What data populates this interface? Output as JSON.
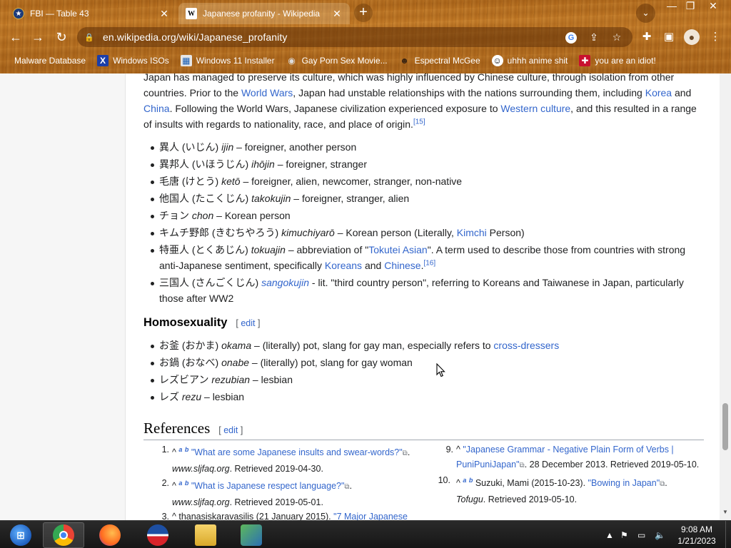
{
  "browser": {
    "tabs": [
      {
        "title": "FBI — Table 43",
        "icon": "fbi-seal-icon"
      },
      {
        "title": "Japanese profanity - Wikipedia",
        "icon": "wikipedia-icon"
      }
    ],
    "url": "en.wikipedia.org/wiki/Japanese_profanity",
    "bookmarks": [
      {
        "label": "Malware Database",
        "icon": "none"
      },
      {
        "label": "Windows ISOs",
        "icon": "x-icon"
      },
      {
        "label": "Windows 11 Installer",
        "icon": "window-icon"
      },
      {
        "label": "Gay Porn Sex Movie...",
        "icon": "globe-icon"
      },
      {
        "label": "Espectral McGee",
        "icon": "mask-icon"
      },
      {
        "label": "uhhh anime shit",
        "icon": "anime-icon"
      },
      {
        "label": "you are an idiot!",
        "icon": "flag-icon"
      }
    ]
  },
  "article": {
    "intro": {
      "t1": "Japan has managed to preserve its culture, which was highly influenced by Chinese culture, through isolation from other countries. Prior to the ",
      "l1": "World Wars",
      "t2": ", Japan had unstable relationships with the nations surrounding them, including ",
      "l2": "Korea",
      "t3": " and ",
      "l3": "China",
      "t4": ". Following the World Wars, Japanese civilization experienced exposure to ",
      "l4": "Western culture",
      "t5": ", and this resulted in a range of insults with regards to nationality, race, and place of origin.",
      "cite": "[15]"
    },
    "nationality_items": [
      {
        "jp": "異人 (いじん) ",
        "rom": "ijin",
        "def": " – foreigner, another person"
      },
      {
        "jp": "異邦人 (いほうじん) ",
        "rom": "ihōjin",
        "def": " – foreigner, stranger"
      },
      {
        "jp": "毛唐 (けとう) ",
        "rom": "ketō",
        "def": " – foreigner, alien, newcomer, stranger, non-native"
      },
      {
        "jp": "他国人 (たこくじん) ",
        "rom": "takokujin",
        "def": " – foreigner, stranger, alien"
      },
      {
        "jp": "チョン ",
        "rom": "chon",
        "def": " – Korean person"
      }
    ],
    "kimuchi": {
      "jp": "キムチ野郎 (きむちやろう) ",
      "rom": "kimuchiyarō",
      "pre": " – Korean person (Literally, ",
      "link": "Kimchi",
      "post": " Person)"
    },
    "tokuajin": {
      "jp": "特亜人 (とくあじん) ",
      "rom": "tokuajin",
      "pre": " – abbreviation of \"",
      "link1": "Tokutei Asian",
      "mid": "\". A term used to describe those from countries with strong anti-Japanese sentiment, specifically ",
      "link2": "Koreans",
      "and": " and ",
      "link3": "Chinese",
      "end": ".",
      "cite": "[16]"
    },
    "sangokujin": {
      "jp": "三国人 (さんごくじん) ",
      "rom_link": "sangokujin",
      "def": " - lit. \"third country person\", referring to Koreans and Taiwanese in Japan, particularly those after WW2"
    },
    "homosexuality": {
      "heading": "Homosexuality",
      "edit": "edit",
      "okama": {
        "jp": "お釜 (おかま) ",
        "rom": "okama",
        "pre": " – (literally) pot, slang for gay man, especially refers to ",
        "link": "cross-dressers"
      },
      "items": [
        {
          "jp": "お鍋 (おなべ) ",
          "rom": "onabe",
          "def": " – (literally) pot, slang for gay woman"
        },
        {
          "jp": "レズビアン ",
          "rom": "rezubian",
          "def": " – lesbian"
        },
        {
          "jp": "レズ ",
          "rom": "rezu",
          "def": " – lesbian"
        }
      ]
    },
    "references": {
      "heading": "References",
      "edit": "edit",
      "r1": {
        "num": "1.",
        "caret": "^",
        "a": "a",
        "b": "b",
        "title": "\"What are some Japanese insults and swear-words?\"",
        "after": ".",
        "site": "www.sljfaq.org",
        "retr": ". Retrieved 2019-04-30."
      },
      "r2": {
        "num": "2.",
        "caret": "^",
        "a": "a",
        "b": "b",
        "title": "\"What is Japanese respect language?\"",
        "after": ".",
        "site": "www.sljfaq.org",
        "retr": ". Retrieved 2019-05-01."
      },
      "r3": {
        "num": "3.",
        "caret": "^",
        "text": " thanasiskaravasilis (21 January 2015). ",
        "title": "\"7 Major Japanese"
      },
      "r9": {
        "num": "9.",
        "caret": "^",
        "title": "\"Japanese Grammar - Negative Plain Form of Verbs | PuniPuniJapan\"",
        "rest": ". 28 December 2013. Retrieved 2019-05-10."
      },
      "r10": {
        "num": "10.",
        "caret": "^",
        "a": "a",
        "b": "b",
        "text": " Suzuki, Mami (2015-10-23). ",
        "title": "\"Bowing in Japan\"",
        "after": ".",
        "site": "Tofugu",
        "retr": ". Retrieved 2019-05-10."
      }
    }
  },
  "taskbar": {
    "apps": [
      "start-orb-icon",
      "chrome-icon",
      "firefox-icon",
      "obama-logo-icon",
      "file-explorer-icon",
      "network-app-icon"
    ],
    "time": "9:08 AM",
    "date": "1/21/2023"
  }
}
